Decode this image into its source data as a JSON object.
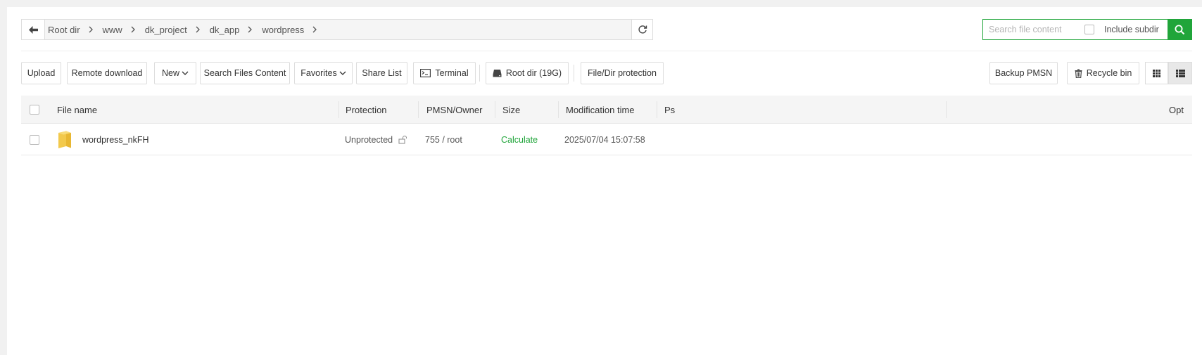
{
  "pathbar": {
    "back_icon": "arrow-left-icon",
    "crumbs": [
      "Root dir",
      "www",
      "dk_project",
      "dk_app",
      "wordpress"
    ],
    "refresh_icon": "refresh-icon"
  },
  "search": {
    "placeholder": "Search file content",
    "value": "",
    "include_subdir_label": "Include subdir",
    "include_subdir_checked": false,
    "button_icon": "search-icon"
  },
  "toolbar": {
    "upload": "Upload",
    "remote_download": "Remote download",
    "new": "New",
    "search_files_content": "Search Files Content",
    "favorites": "Favorites",
    "share_list": "Share List",
    "terminal": "Terminal",
    "root_dir": "Root dir (19G)",
    "file_dir_protection": "File/Dir protection",
    "backup_pmsn": "Backup PMSN",
    "recycle_bin": "Recycle bin",
    "view_grid_icon": "grid-view-icon",
    "view_list_icon": "list-view-icon",
    "active_view": "list"
  },
  "table": {
    "headers": {
      "file_name": "File name",
      "protection": "Protection",
      "pmsn_owner": "PMSN/Owner",
      "size": "Size",
      "modification_time": "Modification time",
      "ps": "Ps",
      "opt": "Opt"
    },
    "rows": [
      {
        "name": "wordpress_nkFH",
        "type_icon": "folder-icon",
        "protection": "Unprotected",
        "protection_icon": "unlock-icon",
        "pmsn_owner": "755 / root",
        "size": "Calculate",
        "modification_time": "2025/07/04 15:07:58",
        "ps": ""
      }
    ]
  },
  "colors": {
    "accent": "#20a53a",
    "border": "#dddddd",
    "header_bg": "#f5f5f5"
  }
}
